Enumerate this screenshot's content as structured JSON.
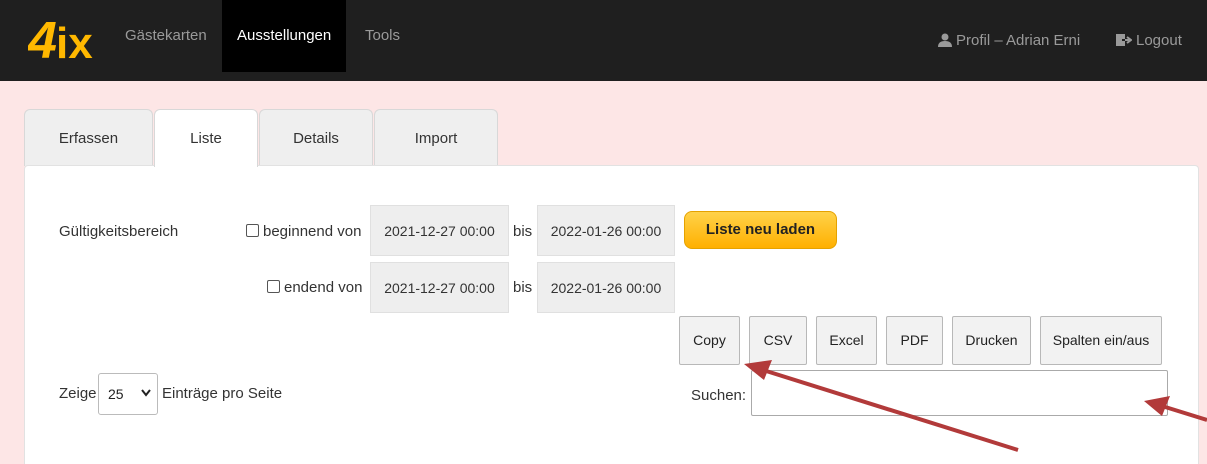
{
  "brand": {
    "logo_text": "4ix"
  },
  "nav": {
    "items": [
      {
        "label": "Gästekarten"
      },
      {
        "label": "Ausstellungen"
      },
      {
        "label": "Tools"
      }
    ],
    "profile_label": "Profil – Adrian Erni",
    "logout_label": "Logout"
  },
  "tabs": [
    {
      "label": "Erfassen"
    },
    {
      "label": "Liste"
    },
    {
      "label": "Details"
    },
    {
      "label": "Import"
    }
  ],
  "filter": {
    "label": "Gültigkeitsbereich",
    "start": {
      "checkbox_label": "beginnend von",
      "from": "2021-12-27 00:00",
      "sep": "bis",
      "to": "2022-01-26 00:00"
    },
    "end": {
      "checkbox_label": "endend von",
      "from": "2021-12-27 00:00",
      "sep": "bis",
      "to": "2022-01-26 00:00"
    },
    "reload_label": "Liste neu laden"
  },
  "toolbar": {
    "buttons": [
      {
        "label": "Copy"
      },
      {
        "label": "CSV"
      },
      {
        "label": "Excel"
      },
      {
        "label": "PDF"
      },
      {
        "label": "Drucken"
      },
      {
        "label": "Spalten ein/aus"
      }
    ]
  },
  "paging": {
    "prefix": "Zeige",
    "value": "25",
    "suffix": "Einträge pro Seite"
  },
  "search": {
    "label": "Suchen:",
    "value": ""
  },
  "colors": {
    "accent": "#ffb000",
    "annotation_arrow": "#b23a3a",
    "navbar": "#1f1f1f",
    "pink_bg": "#fde6e6"
  }
}
